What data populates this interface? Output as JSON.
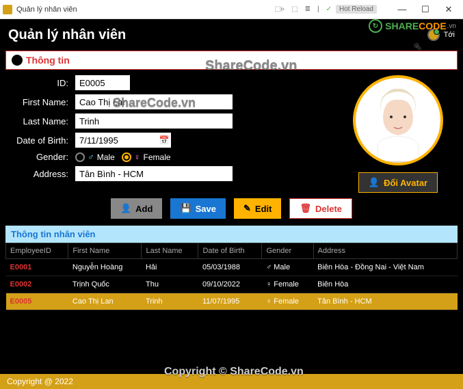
{
  "window": {
    "title": "Quản lý nhân viên",
    "hot_reload": "Hot Reload"
  },
  "header": {
    "title": "Quản lý nhân viên",
    "right_label": "Tới"
  },
  "brand": {
    "label": "SHARECODE",
    "suffix": ".vn"
  },
  "section": {
    "info_title": "Thông tin"
  },
  "form": {
    "id_label": "ID:",
    "id_value": "E0005",
    "first_label": "First Name:",
    "first_value": "Cao Thị Lan",
    "last_label": "Last Name:",
    "last_value": "Trinh",
    "dob_label": "Date of Birth:",
    "dob_value": "7/11/1995",
    "gender_label": "Gender:",
    "male_label": "Male",
    "female_label": "Female",
    "address_label": "Address:",
    "address_value": "Tân Bình - HCM"
  },
  "avatar": {
    "button_label": "Đổi Avatar"
  },
  "actions": {
    "add": "Add",
    "save": "Save",
    "edit": "Edit",
    "delete": "Delete"
  },
  "table": {
    "title": "Thông tin nhân viên",
    "cols": {
      "id": "EmployeeID",
      "first": "First Name",
      "last": "Last Name",
      "dob": "Date of Birth",
      "gender": "Gender",
      "address": "Address"
    },
    "rows": [
      {
        "id": "E0001",
        "first": "Nguyễn Hoàng",
        "last": "Hải",
        "dob": "05/03/1988",
        "gender_sym": "♂",
        "gender": "Male",
        "address": "Biên Hòa - Đồng Nai - Việt Nam"
      },
      {
        "id": "E0002",
        "first": "Trịnh Quốc",
        "last": "Thu",
        "dob": "09/10/2022",
        "gender_sym": "♀",
        "gender": "Female",
        "address": "Biên Hòa"
      },
      {
        "id": "E0005",
        "first": "Cao Thị Lan",
        "last": "Trinh",
        "dob": "11/07/1995",
        "gender_sym": "♀",
        "gender": "Female",
        "address": "Tân Bình - HCM"
      }
    ]
  },
  "footer": {
    "copyright": "Copyright @ 2022"
  },
  "watermarks": {
    "w1": "ShareCode.vn",
    "w2": "ShareCode.vn",
    "w3": "Copyright © ShareCode.vn"
  }
}
